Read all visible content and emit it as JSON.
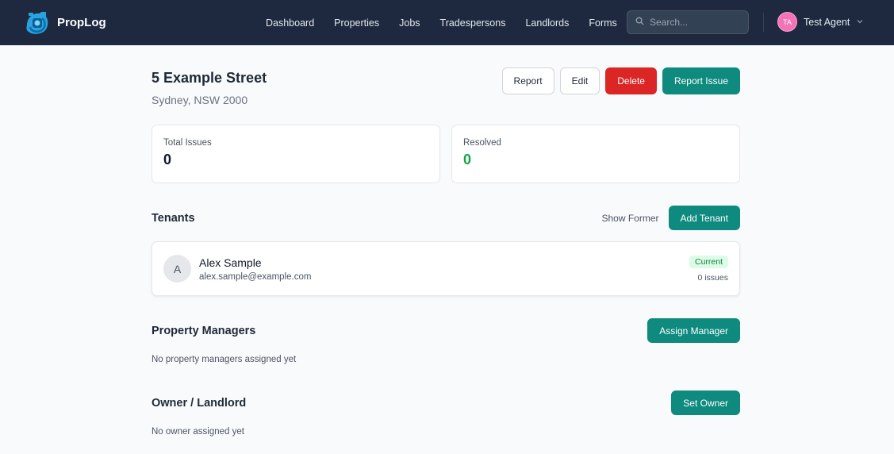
{
  "brand": {
    "name": "PropLog"
  },
  "nav": {
    "items": [
      {
        "label": "Dashboard"
      },
      {
        "label": "Properties"
      },
      {
        "label": "Jobs"
      },
      {
        "label": "Tradespersons"
      },
      {
        "label": "Landlords"
      },
      {
        "label": "Forms"
      }
    ],
    "search_placeholder": "Search...",
    "user": {
      "initials": "TA",
      "name": "Test Agent"
    }
  },
  "property": {
    "title": "5 Example Street",
    "subtitle": "Sydney, NSW 2000",
    "actions": {
      "report": "Report",
      "edit": "Edit",
      "delete": "Delete",
      "report_issue": "Report Issue"
    }
  },
  "stats": [
    {
      "label": "Total Issues",
      "value": "0",
      "color": "#111827"
    },
    {
      "label": "Resolved",
      "value": "0",
      "color": "#16a34a"
    }
  ],
  "tenants": {
    "title": "Tenants",
    "show_former": "Show Former",
    "add_button": "Add Tenant",
    "list": [
      {
        "initial": "A",
        "name": "Alex Sample",
        "email": "alex.sample@example.com",
        "status": "Current",
        "issues": "0 issues"
      }
    ]
  },
  "managers": {
    "title": "Property Managers",
    "button": "Assign Manager",
    "empty": "No property managers assigned yet"
  },
  "owner": {
    "title": "Owner / Landlord",
    "button": "Set Owner",
    "empty": "No owner assigned yet"
  },
  "colors": {
    "header_bg": "#1e2940",
    "accent": "#0f8a7e",
    "danger": "#dc2626",
    "success": "#16a34a"
  }
}
